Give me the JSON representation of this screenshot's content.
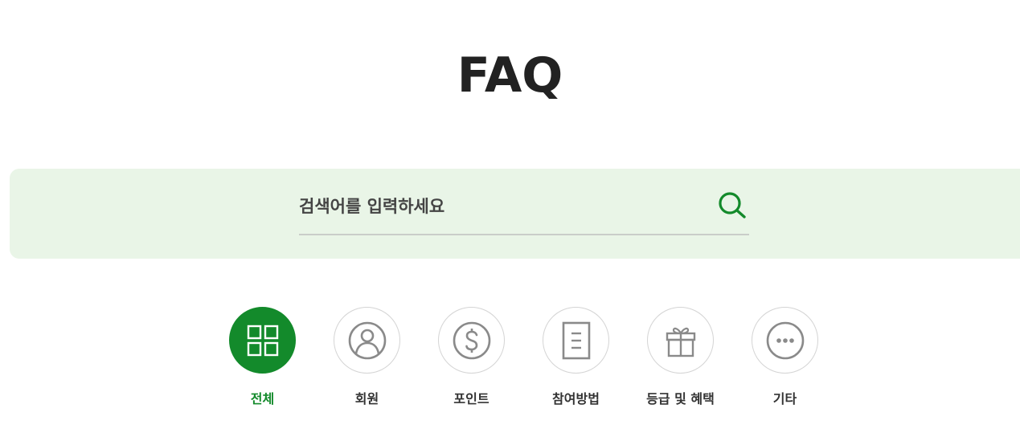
{
  "header": {
    "title": "FAQ"
  },
  "search": {
    "placeholder": "검색어를 입력하세요",
    "value": "",
    "icon": "search-icon"
  },
  "categories": [
    {
      "label": "전체",
      "icon": "grid-icon",
      "active": true
    },
    {
      "label": "회원",
      "icon": "user-icon",
      "active": false
    },
    {
      "label": "포인트",
      "icon": "dollar-icon",
      "active": false
    },
    {
      "label": "참여방법",
      "icon": "document-icon",
      "active": false
    },
    {
      "label": "등급 및 혜택",
      "icon": "gift-icon",
      "active": false
    },
    {
      "label": "기타",
      "icon": "more-icon",
      "active": false
    }
  ],
  "colors": {
    "accent": "#138a2b",
    "band": "#e9f5e7",
    "icon_gray": "#8a8a8a"
  }
}
